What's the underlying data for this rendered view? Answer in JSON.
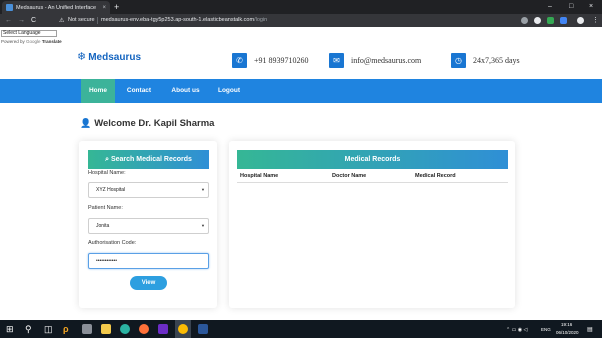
{
  "browser": {
    "tab_title": "Medsaurus - An Unified Interface",
    "tab_close": "×",
    "new_tab": "+",
    "nav": {
      "back": "←",
      "forward": "→",
      "reload": "C"
    },
    "secure_label": "Not secure",
    "url_host": "medsaurus-env.eba-tgy5p253.ap-south-1.elasticbeanstalk.com",
    "url_path": "/login",
    "window_controls": {
      "minimize": "–",
      "maximize": "□",
      "close": "×"
    }
  },
  "translate": {
    "select_value": "Select Language",
    "powered_prefix": "Powered by",
    "google": "Google",
    "translate_word": "Translate"
  },
  "header": {
    "brand": "Medsaurus",
    "phone": "+91 8939710260",
    "email": "info@medsaurus.com",
    "hours": "24x7,365 days"
  },
  "nav": {
    "items": [
      {
        "label": "Home",
        "active": true
      },
      {
        "label": "Contact",
        "active": false
      },
      {
        "label": "About us",
        "active": false
      },
      {
        "label": "Logout",
        "active": false
      }
    ]
  },
  "welcome": "Welcome Dr. Kapil Sharma",
  "search": {
    "title": "Search Medical Records",
    "hospital_label": "Hospital Name:",
    "hospital_value": "XYZ Hospital",
    "patient_label": "Patient Name:",
    "patient_value": "Jonita",
    "auth_label": "Authorisation Code:",
    "auth_value": "••••••••••••",
    "view_button": "View"
  },
  "records": {
    "title": "Medical Records",
    "columns": [
      "Hospital Name",
      "Doctor Name",
      "Medical Record"
    ]
  },
  "taskbar": {
    "language": "ENG",
    "time": "19:16",
    "date": "06/10/2020"
  },
  "colors": {
    "brand_blue": "#1565c0",
    "nav_blue": "#1f84e0",
    "active_green": "#3cb39a",
    "button_blue": "#2d9fe0"
  }
}
